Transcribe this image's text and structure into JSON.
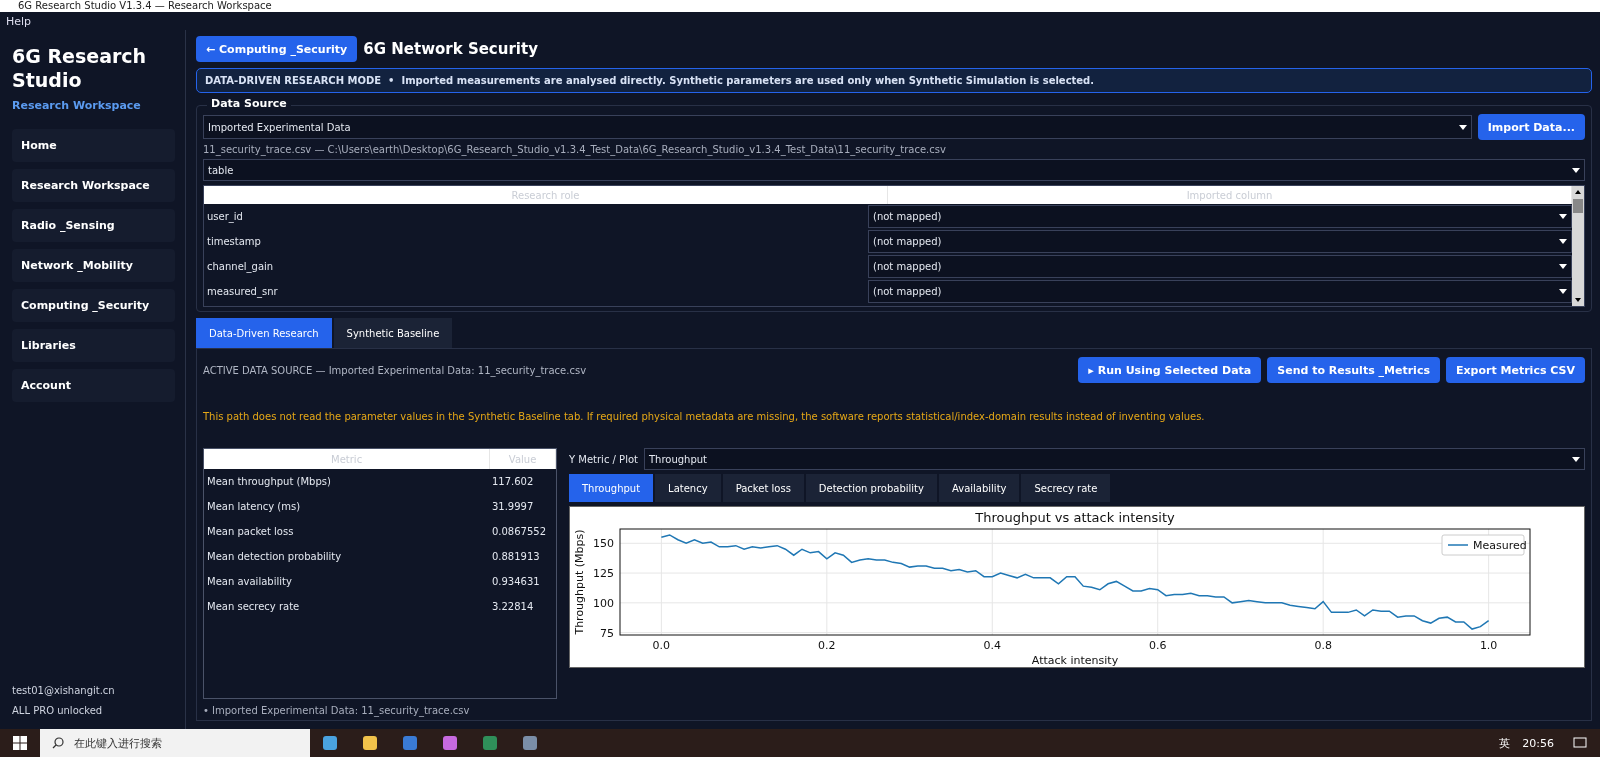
{
  "window": {
    "title": "6G Research Studio V1.3.4 — Research Workspace"
  },
  "menu": [
    "Help"
  ],
  "sidebar": {
    "title": "6G Research Studio",
    "subtitle": "Research Workspace",
    "items": [
      {
        "label": "Home",
        "selected": false
      },
      {
        "label": "Research Workspace",
        "selected": false
      },
      {
        "label": "Radio _Sensing",
        "selected": false
      },
      {
        "label": "Network _Mobility",
        "selected": false
      },
      {
        "label": "Computing _Security",
        "selected": false
      },
      {
        "label": "Libraries",
        "selected": false
      },
      {
        "label": "Account",
        "selected": false
      }
    ],
    "user": "test01@xishangit.cn",
    "license": "ALL PRO unlocked"
  },
  "header": {
    "back_button": "← Computing _Security",
    "title": "6G Network Security"
  },
  "banner": "**DATA-DRIVEN RESEARCH MODE**  •  Imported measurements are analysed directly. Synthetic parameters are used only when Synthetic Simulation is selected.",
  "data_source": {
    "title": "Data Source",
    "source": "Imported Experimental Data",
    "import_button": "Import Data...",
    "file_path": "11_security_trace.csv — C:\\Users\\earth\\Desktop\\6G_Research_Studio_v1.3.4_Test_Data\\6G_Research_Studio_v1.3.4_Test_Data\\11_security_trace.csv",
    "format": "table",
    "mapping": {
      "columns": [
        "Research role",
        "Imported column"
      ],
      "rows": [
        {
          "role": "user_id",
          "column": "(not mapped)"
        },
        {
          "role": "timestamp",
          "column": "(not mapped)"
        },
        {
          "role": "channel_gain",
          "column": "(not mapped)"
        },
        {
          "role": "measured_snr",
          "column": "(not mapped)"
        }
      ]
    }
  },
  "tabs": [
    {
      "label": "Data-Driven Research",
      "selected": true
    },
    {
      "label": "Synthetic Baseline",
      "selected": false
    }
  ],
  "active_source": "ACTIVE DATA SOURCE — Imported Experimental Data: 11_security_trace.csv",
  "actions": [
    "▸ Run Using Selected Data",
    "Send to Results _Metrics",
    "Export Metrics CSV"
  ],
  "warning": "This path does not read the parameter values in the Synthetic Baseline tab. If required physical metadata are missing, the software reports statistical/index-domain results instead of inventing values.",
  "metrics": {
    "columns": [
      "Metric",
      "Value"
    ],
    "rows": [
      {
        "metric": "Mean throughput (Mbps)",
        "value": "117.602"
      },
      {
        "metric": "Mean latency (ms)",
        "value": "31.9997"
      },
      {
        "metric": "Mean packet loss",
        "value": "0.0867552"
      },
      {
        "metric": "Mean detection probability",
        "value": "0.881913"
      },
      {
        "metric": "Mean availability",
        "value": "0.934631"
      },
      {
        "metric": "Mean secrecy rate",
        "value": "3.22814"
      }
    ],
    "footnote": "• Imported Experimental Data: 11_security_trace.csv"
  },
  "plot": {
    "selector_label": "Y Metric / Plot",
    "selector_value": "Throughput",
    "tabs": [
      {
        "label": "Throughput",
        "selected": true
      },
      {
        "label": "Latency",
        "selected": false
      },
      {
        "label": "Packet loss",
        "selected": false
      },
      {
        "label": "Detection probability",
        "selected": false
      },
      {
        "label": "Availability",
        "selected": false
      },
      {
        "label": "Secrecy rate",
        "selected": false
      }
    ],
    "chart_data": {
      "type": "line",
      "title": "Throughput vs attack intensity",
      "xlabel": "Attack intensity",
      "ylabel": "Throughput (Mbps)",
      "x": [
        0,
        0.01,
        0.02,
        0.03,
        0.04,
        0.05,
        0.06,
        0.07,
        0.08,
        0.09,
        0.1,
        0.11,
        0.12,
        0.13,
        0.14,
        0.15,
        0.16,
        0.17,
        0.18,
        0.19,
        0.2,
        0.21,
        0.22,
        0.23,
        0.24,
        0.25,
        0.26,
        0.27,
        0.28,
        0.29,
        0.3,
        0.31,
        0.32,
        0.33,
        0.34,
        0.35,
        0.36,
        0.37,
        0.38,
        0.39,
        0.4,
        0.41,
        0.42,
        0.43,
        0.44,
        0.45,
        0.46,
        0.47,
        0.48,
        0.49,
        0.5,
        0.51,
        0.52,
        0.53,
        0.54,
        0.55,
        0.56,
        0.57,
        0.58,
        0.59,
        0.6,
        0.61,
        0.62,
        0.63,
        0.64,
        0.65,
        0.66,
        0.67,
        0.68,
        0.69,
        0.7,
        0.71,
        0.72,
        0.73,
        0.74,
        0.75,
        0.76,
        0.77,
        0.78,
        0.79,
        0.8,
        0.81,
        0.82,
        0.83,
        0.84,
        0.85,
        0.86,
        0.87,
        0.88,
        0.89,
        0.9,
        0.91,
        0.92,
        0.93,
        0.94,
        0.95,
        0.96,
        0.97,
        0.98,
        0.99,
        1
      ],
      "series": [
        {
          "name": "Measured",
          "color": "#1f77b4",
          "values": [
            155,
            157,
            153,
            150,
            153,
            150,
            151,
            147,
            147,
            148,
            145,
            147,
            146,
            147,
            148,
            145,
            140,
            145,
            142,
            143,
            137,
            142,
            140,
            134,
            136,
            137,
            136,
            136,
            134,
            133,
            130,
            131,
            131,
            129,
            129,
            127,
            128,
            126,
            127,
            122,
            122,
            125,
            123,
            121,
            124,
            121,
            121,
            121,
            116,
            122,
            122,
            114,
            113,
            111,
            116,
            118,
            114,
            110,
            110,
            112,
            111,
            106,
            107,
            107,
            108,
            106,
            106,
            105,
            105,
            100,
            101,
            102,
            101,
            100,
            100,
            100,
            98,
            97,
            96,
            95,
            101,
            92,
            92,
            92,
            94,
            89,
            94,
            93,
            93,
            88,
            89,
            89,
            85,
            83,
            87,
            88,
            84,
            84,
            78,
            80,
            85
          ]
        }
      ],
      "xlim": [
        -0.05,
        1.05
      ],
      "ylim": [
        73,
        162
      ],
      "xticks": [
        {
          "value": 0,
          "label": "0.0"
        },
        {
          "value": 0.2,
          "label": "0.2"
        },
        {
          "value": 0.4,
          "label": "0.4"
        },
        {
          "value": 0.6,
          "label": "0.6"
        },
        {
          "value": 0.8,
          "label": "0.8"
        },
        {
          "value": 1,
          "label": "1.0"
        }
      ],
      "yticks": [
        75,
        100,
        125,
        150
      ],
      "grid": true
    }
  },
  "taskbar": {
    "search_placeholder": "在此键入进行搜索",
    "ime": "英",
    "time": "20:56"
  }
}
